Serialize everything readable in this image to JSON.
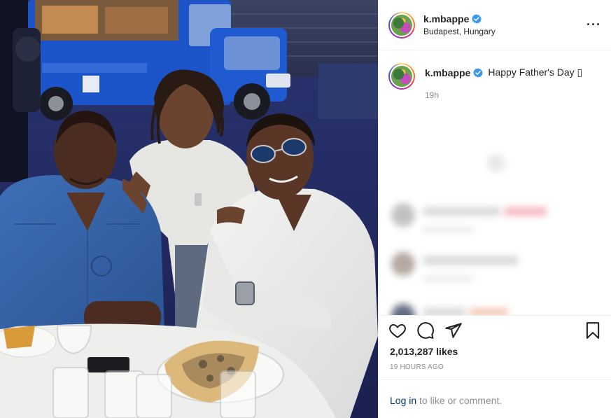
{
  "post": {
    "username": "k.mbappe",
    "location": "Budapest, Hungary",
    "caption": "Happy Father's Day ▯",
    "posted_relative": "19h",
    "likes": "2,013,287 likes",
    "posted_ago": "19 HOURS AGO"
  },
  "login": {
    "link": "Log in",
    "suffix": "to like or comment."
  },
  "icons": {
    "verified": "verified-badge-icon",
    "more": "more-options-icon",
    "like": "heart-icon",
    "comment": "comment-bubble-icon",
    "share": "paper-plane-icon",
    "save": "bookmark-icon"
  },
  "colors": {
    "verified_blue": "#3897f0",
    "link_blue": "#00376b",
    "muted": "#8e8e8e",
    "text": "#262626"
  }
}
